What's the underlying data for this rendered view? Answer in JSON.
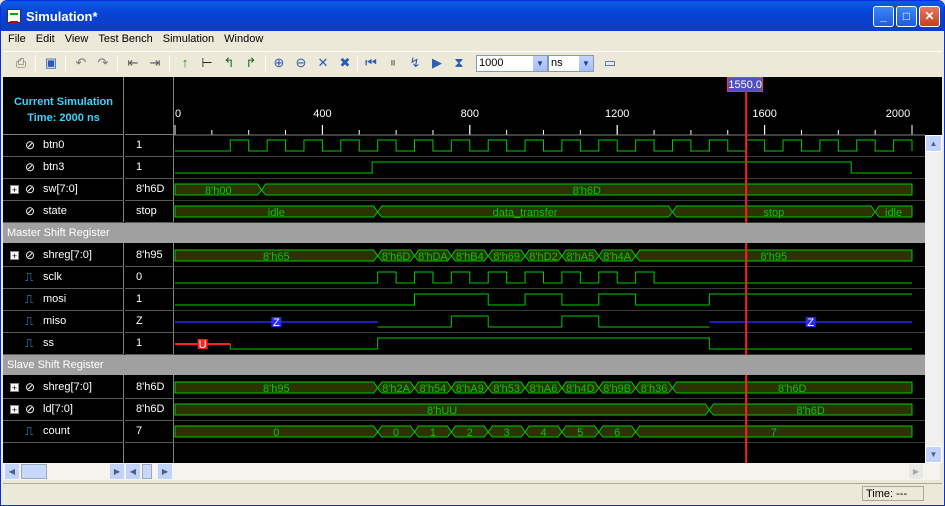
{
  "window": {
    "title": "Simulation*"
  },
  "menu": [
    "File",
    "Edit",
    "View",
    "Test Bench",
    "Simulation",
    "Window"
  ],
  "toolbar": {
    "run_time": "1000",
    "time_unit": "ns"
  },
  "panel": {
    "header_line1": "Current Simulation",
    "header_line2": "Time: 2000 ns"
  },
  "timeline": {
    "ticks": [
      {
        "t": 0,
        "label": "0"
      },
      {
        "t": 400,
        "label": "400"
      },
      {
        "t": 800,
        "label": "800"
      },
      {
        "t": 1200,
        "label": "1200"
      },
      {
        "t": 1600,
        "label": "1600"
      },
      {
        "t": 2000,
        "label": "2000"
      }
    ],
    "cursor_label": "1550.0",
    "cursor_time": 1550,
    "range": [
      0,
      2000
    ]
  },
  "signals": [
    {
      "name": "btn0",
      "value": "1",
      "kind": "bit",
      "icon": "input-bit-icon",
      "expand": false
    },
    {
      "name": "btn3",
      "value": "1",
      "kind": "bit",
      "icon": "input-bit-icon",
      "expand": false
    },
    {
      "name": "sw[7:0]",
      "value": "8'h6D",
      "kind": "bus",
      "icon": "input-bus-icon",
      "expand": true
    },
    {
      "name": "state",
      "value": "stop",
      "kind": "bus",
      "icon": "input-bit-icon",
      "expand": false
    },
    {
      "group": "Master Shift Register"
    },
    {
      "name": "shreg[7:0]",
      "value": "8'h95",
      "kind": "bus",
      "icon": "input-bus-icon",
      "expand": true
    },
    {
      "name": "sclk",
      "value": "0",
      "kind": "bit",
      "icon": "output-bit-icon",
      "expand": false
    },
    {
      "name": "mosi",
      "value": "1",
      "kind": "bit",
      "icon": "output-bit-icon",
      "expand": false
    },
    {
      "name": "miso",
      "value": "Z",
      "kind": "bit",
      "icon": "output-bit-icon",
      "expand": false
    },
    {
      "name": "ss",
      "value": "1",
      "kind": "bit",
      "icon": "output-bit-icon",
      "expand": false
    },
    {
      "group": "Slave Shift Register"
    },
    {
      "name": "shreg[7:0]",
      "value": "8'h6D",
      "kind": "bus",
      "icon": "input-bus-icon",
      "expand": true
    },
    {
      "name": "ld[7:0]",
      "value": "8'h6D",
      "kind": "bus",
      "icon": "input-bus-icon",
      "expand": true
    },
    {
      "name": "count",
      "value": "7",
      "kind": "bus",
      "icon": "output-bit-icon",
      "expand": false
    }
  ],
  "waveforms": {
    "btn0": {
      "type": "bit",
      "edges": [
        [
          0,
          0
        ],
        [
          150,
          1
        ],
        [
          200,
          0
        ],
        [
          250,
          1
        ],
        [
          300,
          0
        ],
        [
          350,
          1
        ],
        [
          400,
          0
        ],
        [
          450,
          1
        ],
        [
          500,
          0
        ],
        [
          550,
          1
        ],
        [
          600,
          0
        ],
        [
          650,
          1
        ],
        [
          700,
          0
        ],
        [
          750,
          1
        ],
        [
          800,
          0
        ],
        [
          850,
          1
        ],
        [
          900,
          0
        ],
        [
          950,
          1
        ],
        [
          1000,
          0
        ],
        [
          1050,
          1
        ],
        [
          1100,
          0
        ],
        [
          1150,
          1
        ],
        [
          1200,
          0
        ],
        [
          1250,
          1
        ],
        [
          1300,
          0
        ],
        [
          1350,
          1
        ],
        [
          1400,
          0
        ],
        [
          1450,
          1
        ],
        [
          1500,
          0
        ],
        [
          1550,
          1
        ],
        [
          1600,
          0
        ],
        [
          1650,
          1
        ],
        [
          1700,
          0
        ],
        [
          1750,
          1
        ],
        [
          1800,
          0
        ],
        [
          1850,
          1
        ],
        [
          1900,
          0
        ],
        [
          1950,
          1
        ],
        [
          2000,
          0
        ]
      ]
    },
    "btn3": {
      "type": "bit",
      "edges": [
        [
          0,
          0
        ],
        [
          535,
          1
        ],
        [
          1835,
          0
        ]
      ]
    },
    "sw": {
      "type": "bus",
      "segments": [
        {
          "from": 0,
          "to": 235,
          "label": "8'h00"
        },
        {
          "from": 235,
          "to": 2000,
          "label": "8'h6D"
        }
      ]
    },
    "state": {
      "type": "bus",
      "segments": [
        {
          "from": 0,
          "to": 550,
          "label": "idle"
        },
        {
          "from": 550,
          "to": 1350,
          "label": "data_transfer"
        },
        {
          "from": 1350,
          "to": 1900,
          "label": "stop"
        },
        {
          "from": 1900,
          "to": 2000,
          "label": "idle"
        }
      ]
    },
    "m_shreg": {
      "type": "bus",
      "segments": [
        {
          "from": 0,
          "to": 550,
          "label": "8'h65"
        },
        {
          "from": 550,
          "to": 650,
          "label": "8'h6D"
        },
        {
          "from": 650,
          "to": 750,
          "label": "8'hDA"
        },
        {
          "from": 750,
          "to": 850,
          "label": "8'hB4"
        },
        {
          "from": 850,
          "to": 950,
          "label": "8'h69"
        },
        {
          "from": 950,
          "to": 1050,
          "label": "8'hD2"
        },
        {
          "from": 1050,
          "to": 1150,
          "label": "8'hA5"
        },
        {
          "from": 1150,
          "to": 1250,
          "label": "8'h4A"
        },
        {
          "from": 1250,
          "to": 2000,
          "label": "8'h95"
        }
      ]
    },
    "sclk": {
      "type": "bit",
      "edges": [
        [
          0,
          0
        ],
        [
          550,
          1
        ],
        [
          600,
          0
        ],
        [
          650,
          1
        ],
        [
          700,
          0
        ],
        [
          750,
          1
        ],
        [
          800,
          0
        ],
        [
          850,
          1
        ],
        [
          900,
          0
        ],
        [
          950,
          1
        ],
        [
          1000,
          0
        ],
        [
          1050,
          1
        ],
        [
          1100,
          0
        ],
        [
          1150,
          1
        ],
        [
          1200,
          0
        ],
        [
          1250,
          1
        ],
        [
          1300,
          0
        ]
      ]
    },
    "mosi": {
      "type": "bit",
      "edges": [
        [
          0,
          0
        ],
        [
          650,
          1
        ],
        [
          850,
          0
        ],
        [
          950,
          1
        ],
        [
          1050,
          0
        ],
        [
          1150,
          1
        ],
        [
          1250,
          0
        ],
        [
          1450,
          1
        ]
      ]
    },
    "miso": {
      "type": "bitz",
      "edges": [
        [
          0,
          "Z"
        ],
        [
          550,
          0
        ],
        [
          750,
          1
        ],
        [
          850,
          0
        ],
        [
          1050,
          1
        ],
        [
          1150,
          0
        ],
        [
          1450,
          "Z"
        ]
      ],
      "z_labels": [
        {
          "t": 275,
          "label": "Z"
        },
        {
          "t": 1725,
          "label": "Z"
        }
      ]
    },
    "ss": {
      "type": "bitu",
      "edges": [
        [
          0,
          "U"
        ],
        [
          150,
          0
        ],
        [
          550,
          1
        ],
        [
          1450,
          0
        ],
        [
          2000,
          0
        ]
      ],
      "u_label": "U",
      "u_label_t": 75,
      "final_high_from": 550
    },
    "s_shreg": {
      "type": "bus",
      "segments": [
        {
          "from": 0,
          "to": 550,
          "label": "8'h95"
        },
        {
          "from": 550,
          "to": 650,
          "label": "8'h2A"
        },
        {
          "from": 650,
          "to": 750,
          "label": "8'h54"
        },
        {
          "from": 750,
          "to": 850,
          "label": "8'hA9"
        },
        {
          "from": 850,
          "to": 950,
          "label": "8'h53"
        },
        {
          "from": 950,
          "to": 1050,
          "label": "8'hA6"
        },
        {
          "from": 1050,
          "to": 1150,
          "label": "8'h4D"
        },
        {
          "from": 1150,
          "to": 1250,
          "label": "8'h9B"
        },
        {
          "from": 1250,
          "to": 1350,
          "label": "8'h36"
        },
        {
          "from": 1350,
          "to": 2000,
          "label": "8'h6D"
        }
      ]
    },
    "ld": {
      "type": "bus",
      "segments": [
        {
          "from": 0,
          "to": 1450,
          "label": "8'hUU"
        },
        {
          "from": 1450,
          "to": 2000,
          "label": "8'h6D"
        }
      ]
    },
    "count": {
      "type": "bus",
      "segments": [
        {
          "from": 0,
          "to": 550,
          "label": "0"
        },
        {
          "from": 550,
          "to": 650,
          "label": "0"
        },
        {
          "from": 650,
          "to": 750,
          "label": "1"
        },
        {
          "from": 750,
          "to": 850,
          "label": "2"
        },
        {
          "from": 850,
          "to": 950,
          "label": "3"
        },
        {
          "from": 950,
          "to": 1050,
          "label": "4"
        },
        {
          "from": 1050,
          "to": 1150,
          "label": "5"
        },
        {
          "from": 1150,
          "to": 1250,
          "label": "6"
        },
        {
          "from": 1250,
          "to": 2000,
          "label": "7"
        }
      ]
    }
  },
  "status": {
    "time": "Time: ---"
  },
  "colors": {
    "wave": "#00cc00",
    "bus_fill": "#2b3300",
    "z": "#2828ff",
    "u": "#ff2020",
    "cursor": "#ff2020",
    "header_text": "#36d4ff"
  }
}
